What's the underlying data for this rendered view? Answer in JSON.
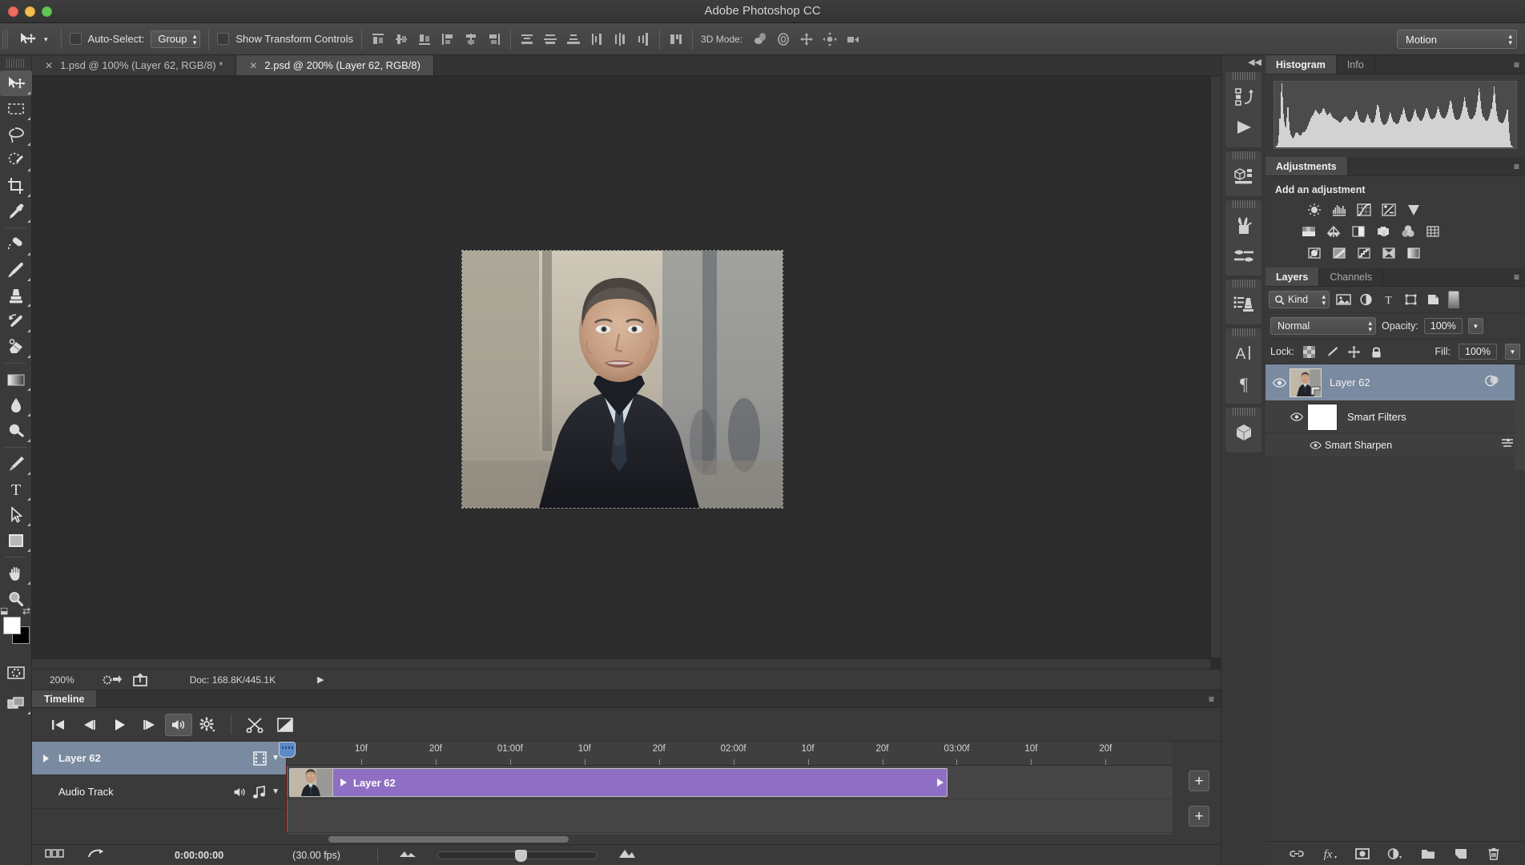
{
  "window": {
    "title": "Adobe Photoshop CC"
  },
  "options_bar": {
    "tool_icon": "move-tool-icon",
    "auto_select_label": "Auto-Select:",
    "auto_select_value": "Group",
    "show_transform_label": "Show Transform Controls",
    "align_icons": [
      "align-left-edges-icon",
      "align-horizontal-centers-icon",
      "align-right-edges-icon",
      "align-top-edges-icon",
      "align-vertical-centers-icon",
      "align-bottom-edges-icon"
    ],
    "distribute_icons": [
      "distribute-top-edges-icon",
      "distribute-vertical-centers-icon",
      "distribute-bottom-edges-icon",
      "distribute-left-edges-icon",
      "distribute-horizontal-centers-icon",
      "distribute-right-edges-icon"
    ],
    "auto_align_icon": "auto-align-layers-icon",
    "mode_3d_label": "3D Mode:",
    "mode_3d_icons": [
      "rotate-3d-icon",
      "roll-3d-icon",
      "pan-3d-icon",
      "slide-3d-icon",
      "scale-3d-icon"
    ],
    "workspace": "Motion"
  },
  "toolbar": {
    "tools": [
      {
        "name": "move-tool",
        "active": true
      },
      {
        "name": "rectangular-marquee-tool",
        "active": false
      },
      {
        "name": "lasso-tool",
        "active": false
      },
      {
        "name": "quick-selection-tool",
        "active": false
      },
      {
        "name": "crop-tool",
        "active": false
      },
      {
        "name": "eyedropper-tool",
        "active": false
      },
      {
        "name": "spot-healing-brush-tool",
        "active": false
      },
      {
        "name": "brush-tool",
        "active": false
      },
      {
        "name": "clone-stamp-tool",
        "active": false
      },
      {
        "name": "history-brush-tool",
        "active": false
      },
      {
        "name": "eraser-tool",
        "active": false
      },
      {
        "name": "gradient-tool",
        "active": false
      },
      {
        "name": "blur-tool",
        "active": false
      },
      {
        "name": "dodge-tool",
        "active": false
      },
      {
        "name": "pen-tool",
        "active": false
      },
      {
        "name": "horizontal-type-tool",
        "active": false
      },
      {
        "name": "path-selection-tool",
        "active": false
      },
      {
        "name": "rectangle-tool",
        "active": false
      },
      {
        "name": "hand-tool",
        "active": false
      },
      {
        "name": "zoom-tool",
        "active": false
      }
    ],
    "foreground_color": "#ffffff",
    "background_color": "#000000",
    "quick_mask_icon": "quick-mask-icon",
    "screen_mode_icon": "screen-mode-icon"
  },
  "document_tabs": [
    {
      "title": "1.psd @ 100% (Layer 62, RGB/8) *",
      "active": false
    },
    {
      "title": "2.psd @ 200% (Layer 62, RGB/8)",
      "active": true
    }
  ],
  "doc_status": {
    "zoom": "200%",
    "doc_info": "Doc: 168.8K/445.1K"
  },
  "icon_dock": {
    "collapse_icon": "collapse-panels-icon",
    "groups": [
      [
        "history-icon",
        "actions-play-icon"
      ],
      [
        "3d-properties-icon"
      ],
      [
        "brush-presets-icon",
        "brushes-icon"
      ],
      [
        "clone-source-icon"
      ],
      [
        "character-icon",
        "paragraph-icon"
      ],
      [
        "3d-panel-icon"
      ]
    ]
  },
  "panels": {
    "histogram": {
      "tabs": [
        {
          "label": "Histogram",
          "active": true
        },
        {
          "label": "Info",
          "active": false
        }
      ],
      "menu_icon": "panel-menu-icon"
    },
    "adjustments": {
      "tabs": [
        {
          "label": "Adjustments",
          "active": true
        }
      ],
      "heading": "Add an adjustment",
      "row1": [
        "brightness-contrast-icon",
        "levels-icon",
        "curves-icon",
        "exposure-icon",
        "vibrance-icon"
      ],
      "row2": [
        "hue-saturation-icon",
        "color-balance-icon",
        "black-white-icon",
        "photo-filter-icon",
        "channel-mixer-icon",
        "color-lookup-icon"
      ],
      "row3": [
        "invert-icon",
        "posterize-icon",
        "threshold-icon",
        "selective-color-icon",
        "gradient-map-icon"
      ]
    },
    "layers": {
      "tabs": [
        {
          "label": "Layers",
          "active": true
        },
        {
          "label": "Channels",
          "active": false
        }
      ],
      "filter_label": "Kind",
      "filter_icons": [
        "filter-pixel-icon",
        "filter-adjustment-icon",
        "filter-type-icon",
        "filter-shape-icon",
        "filter-smartobject-icon"
      ],
      "blend_mode": "Normal",
      "opacity_label": "Opacity:",
      "opacity_value": "100%",
      "lock_label": "Lock:",
      "lock_icons": [
        "lock-transparency-icon",
        "lock-image-icon",
        "lock-position-icon",
        "lock-all-icon"
      ],
      "fill_label": "Fill:",
      "fill_value": "100%",
      "rows": [
        {
          "type": "layer",
          "name": "Layer 62",
          "selected": true,
          "visible": true,
          "smart_object": true
        },
        {
          "type": "smart-filters",
          "name": "Smart Filters",
          "selected": false,
          "visible": true
        },
        {
          "type": "filter",
          "name": "Smart Sharpen",
          "selected": false,
          "visible": true
        }
      ],
      "footer_icons": [
        "link-layers-icon",
        "add-layer-style-icon",
        "add-layer-mask-icon",
        "new-adjustment-layer-icon",
        "new-group-icon",
        "new-layer-icon",
        "delete-layer-icon"
      ]
    }
  },
  "timeline": {
    "tabs": [
      {
        "label": "Timeline",
        "active": true
      }
    ],
    "menu_icon": "panel-menu-icon",
    "controls": [
      {
        "name": "go-to-first-frame-button",
        "icon": "skip-start-icon",
        "active": false
      },
      {
        "name": "previous-frame-button",
        "icon": "step-back-icon",
        "active": false
      },
      {
        "name": "play-button",
        "icon": "play-icon",
        "active": false
      },
      {
        "name": "next-frame-button",
        "icon": "step-forward-icon",
        "active": false
      },
      {
        "name": "audio-toggle-button",
        "icon": "speaker-icon",
        "active": true
      },
      {
        "name": "render-settings-button",
        "icon": "gear-icon",
        "active": false
      },
      {
        "name": "split-clip-button",
        "icon": "scissors-icon",
        "active": false
      },
      {
        "name": "transition-button",
        "icon": "transition-icon",
        "active": false
      }
    ],
    "ruler_ticks": [
      "10f",
      "20f",
      "01:00f",
      "10f",
      "20f",
      "02:00f",
      "10f",
      "20f",
      "03:00f",
      "10f",
      "20f"
    ],
    "tracks": [
      {
        "name": "Layer 62",
        "type": "video",
        "selected": true,
        "right_icons": [
          "filmstrip-icon",
          "chevron-down-icon"
        ]
      },
      {
        "name": "Audio Track",
        "type": "audio",
        "selected": false,
        "right_icons": [
          "speaker-icon",
          "music-note-icon",
          "chevron-down-icon"
        ]
      }
    ],
    "clip": {
      "name": "Layer 62",
      "color": "#8f6fc4"
    },
    "add_buttons": [
      "add-media-button",
      "add-audio-button"
    ],
    "footer": {
      "frame_mode_icon": "frame-animation-icon",
      "convert_icon": "convert-to-frames-icon",
      "timecode": "0:00:00:00",
      "fps": "(30.00 fps)",
      "zoom_icon": "zoom-timeline-icon"
    }
  }
}
